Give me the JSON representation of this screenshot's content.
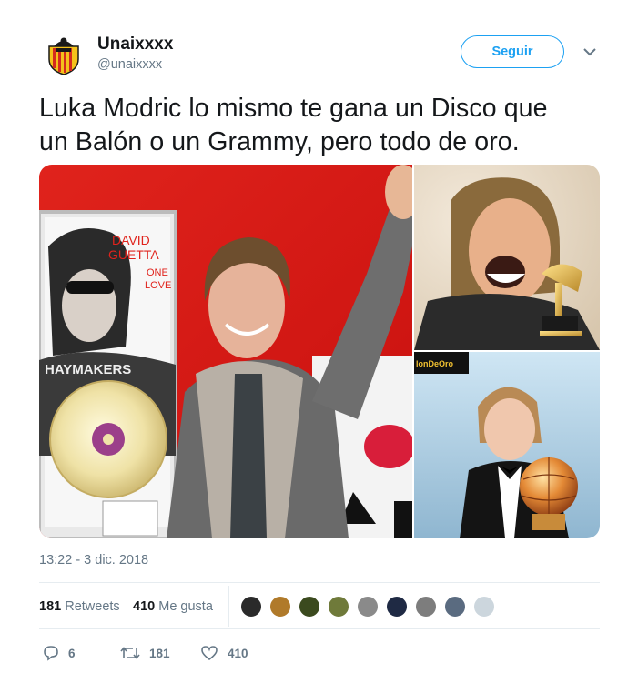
{
  "user": {
    "display_name": "Unaixxxx",
    "handle": "@unaixxxx"
  },
  "follow_label": "Seguir",
  "tweet": {
    "text_line1": "Luka Modric lo mismo te gana un Disco que",
    "text_line2": "un Balón o un Grammy, pero todo de oro."
  },
  "media": {
    "images": [
      {
        "name": "david-guetta-gold-disc",
        "overlay_text": [
          "DAVID",
          "GUETTA",
          "ONE",
          "LOVE",
          "HAYMAKERS"
        ]
      },
      {
        "name": "david-guetta-grammy"
      },
      {
        "name": "luka-modric-ballon-dor",
        "overlay_text": "lonDeOro"
      }
    ]
  },
  "timestamp": "13:22 - 3 dic. 2018",
  "stats": {
    "retweets_count": "181",
    "retweets_label": "Retweets",
    "likes_count": "410",
    "likes_label": "Me gusta"
  },
  "likers": [
    {
      "color": "#2a2a2a"
    },
    {
      "color": "#b07a2a"
    },
    {
      "color": "#3b4a1e"
    },
    {
      "color": "#6f7a3a"
    },
    {
      "color": "#8a8a8a"
    },
    {
      "color": "#1f2a44"
    },
    {
      "color": "#7d7d7d"
    },
    {
      "color": "#5a6b80"
    },
    {
      "color": "#ccd6dd"
    }
  ],
  "actions": {
    "replies": "6",
    "retweets": "181",
    "likes": "410"
  },
  "colors": {
    "accent": "#1da1f2",
    "secondary_text": "#657786",
    "divider": "#e6ecf0"
  }
}
